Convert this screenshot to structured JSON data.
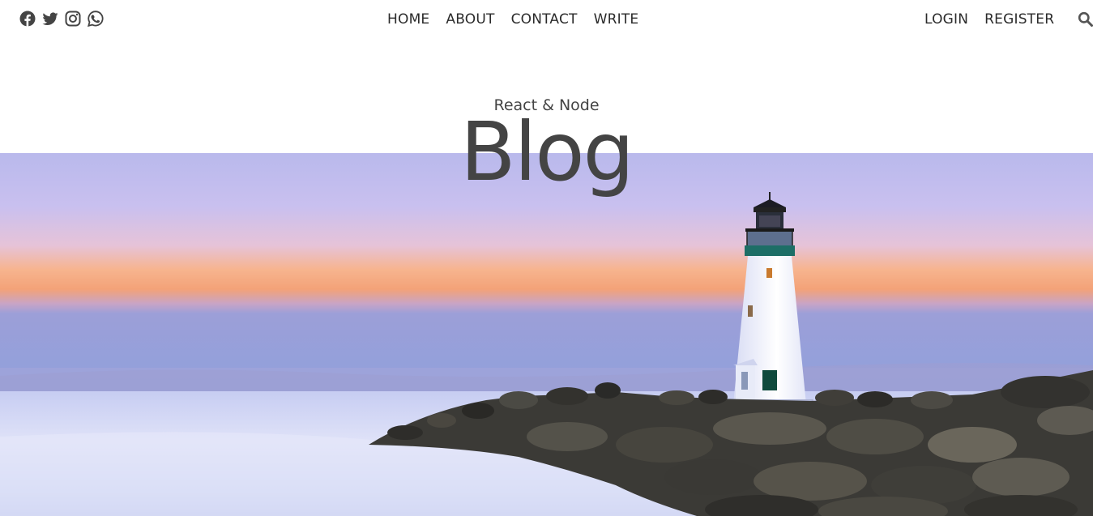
{
  "social": {
    "icons": [
      "facebook-icon",
      "twitter-icon",
      "instagram-icon",
      "whatsapp-icon"
    ],
    "icon_color": "#444444"
  },
  "nav": {
    "home": "HOME",
    "about": "ABOUT",
    "contact": "CONTACT",
    "write": "WRITE"
  },
  "auth": {
    "login": "LOGIN",
    "register": "REGISTER"
  },
  "search": {
    "icon": "search-icon",
    "color": "#555555"
  },
  "hero": {
    "subtitle": "React & Node",
    "title": "Blog",
    "image": "lighthouse-sunset-photo"
  }
}
